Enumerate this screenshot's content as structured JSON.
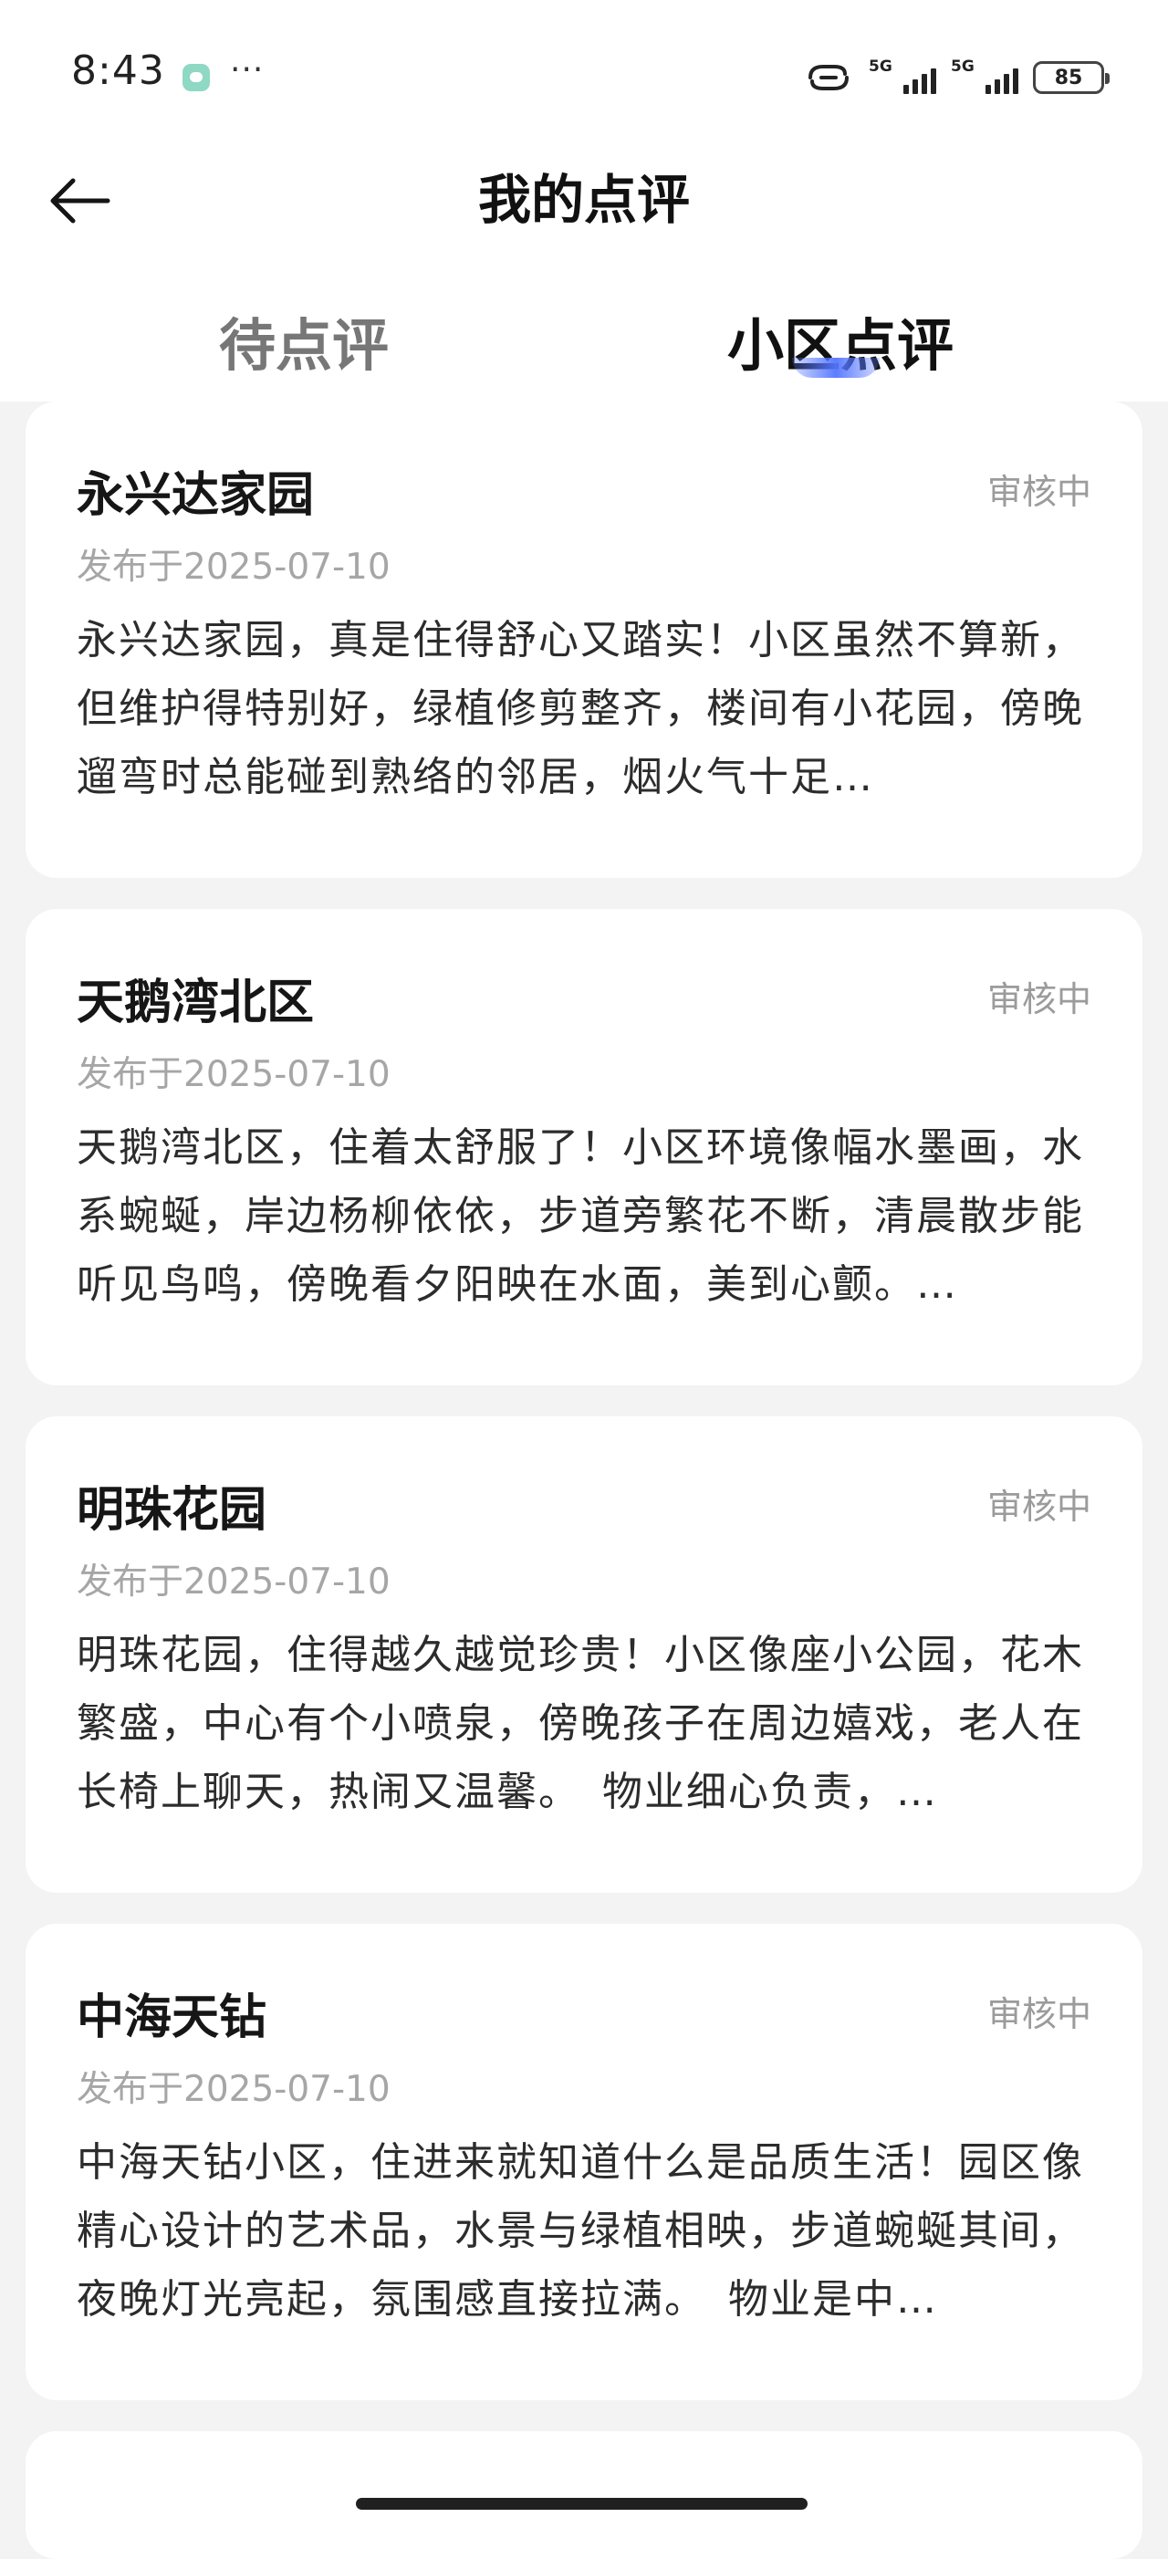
{
  "status_bar": {
    "time": "8:43",
    "more": "···",
    "signal1": "5G",
    "signal2": "5G",
    "battery": "85"
  },
  "header": {
    "title": "我的点评"
  },
  "tabs": [
    {
      "label": "待点评",
      "active": false
    },
    {
      "label": "小区点评",
      "active": true
    }
  ],
  "reviews": [
    {
      "name": "永兴达家园",
      "status": "审核中",
      "date": "发布于2025-07-10",
      "text": "永兴达家园，真是住得舒心又踏实！小区虽然不算新，但维护得特别好，绿植修剪整齐，楼间有小花园，傍晚遛弯时总能碰到熟络的邻居，烟火气十足…"
    },
    {
      "name": "天鹅湾北区",
      "status": "审核中",
      "date": "发布于2025-07-10",
      "text": "天鹅湾北区，住着太舒服了！小区环境像幅水墨画，水系蜿蜒，岸边杨柳依依，步道旁繁花不断，清晨散步能听见鸟鸣，傍晚看夕阳映在水面，美到心颤。…"
    },
    {
      "name": "明珠花园",
      "status": "审核中",
      "date": "发布于2025-07-10",
      "text": "明珠花园，住得越久越觉珍贵！小区像座小公园，花木繁盛，中心有个小喷泉，傍晚孩子在周边嬉戏，老人在长椅上聊天，热闹又温馨。　物业细心负责，…"
    },
    {
      "name": "中海天钻",
      "status": "审核中",
      "date": "发布于2025-07-10",
      "text": "中海天钻小区，住进来就知道什么是品质生活！园区像精心设计的艺术品，水景与绿植相映，步道蜿蜒其间，夜晚灯光亮起，氛围感直接拉满。　物业是中…"
    }
  ],
  "colors": {
    "background": "#f3f3f4",
    "card": "#ffffff",
    "accent": "#5475ff",
    "muted_text": "#a6a6a6"
  }
}
